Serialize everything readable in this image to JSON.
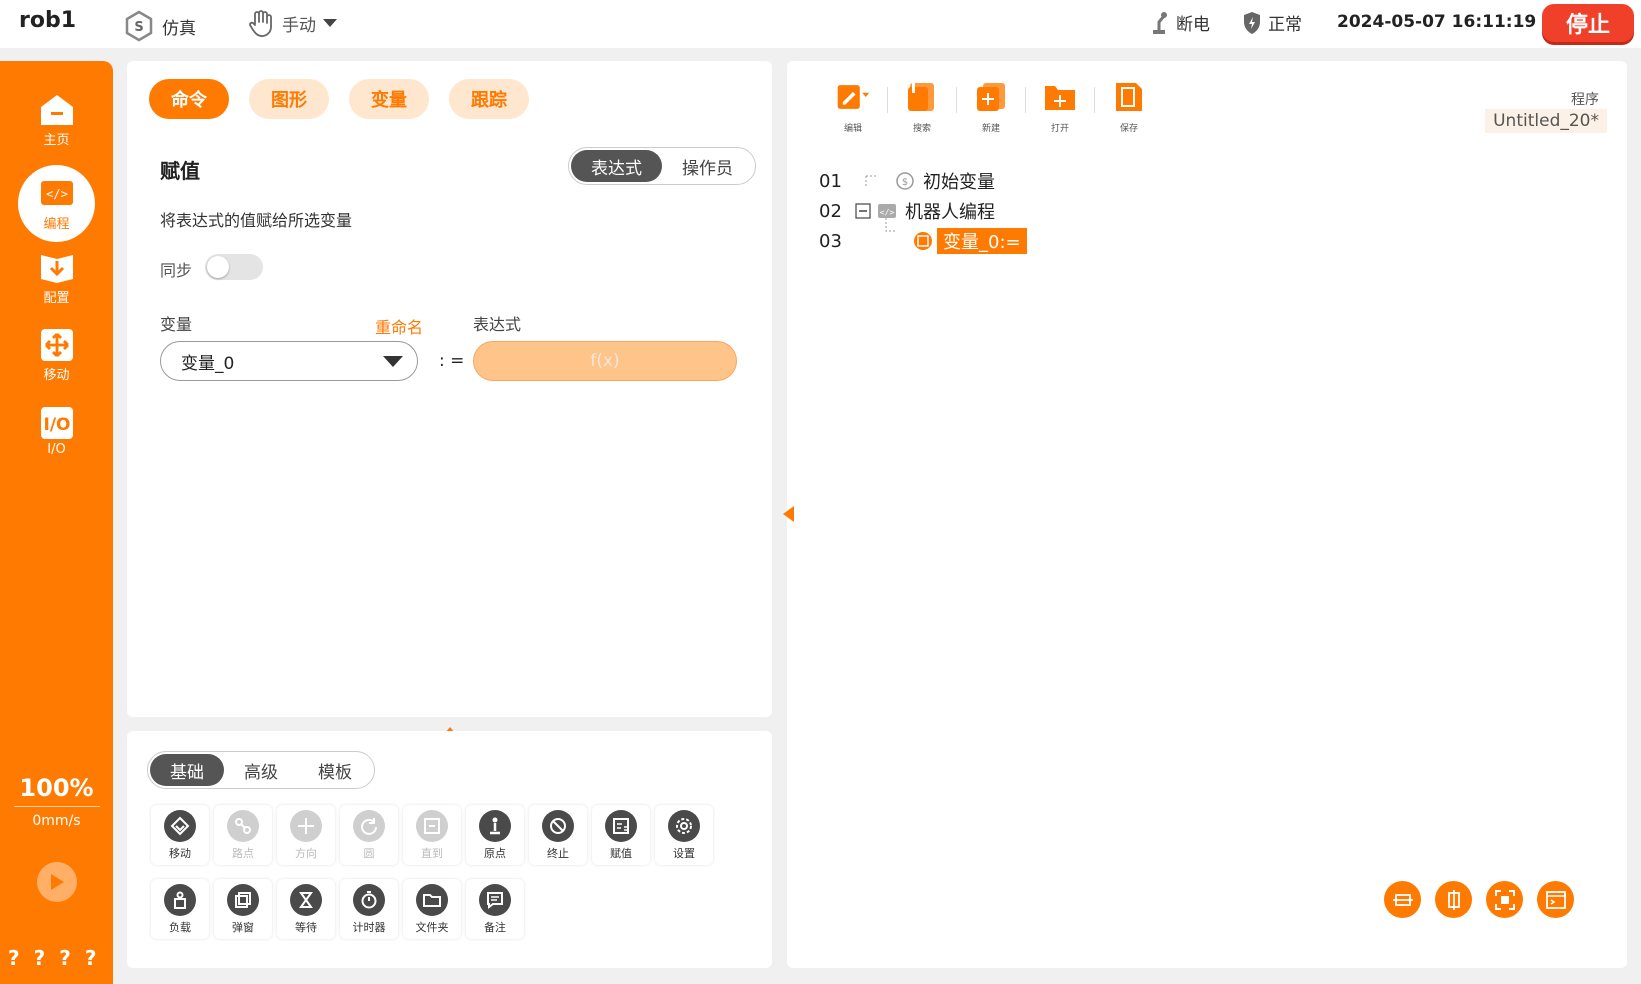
{
  "header": {
    "robot_name": "rob1",
    "sim_label": "仿真",
    "mode_label": "手动",
    "power_label": "断电",
    "status_label": "正常",
    "datetime": "2024-05-07 16:11:19",
    "stop_label": "停止"
  },
  "sidebar": {
    "items": [
      {
        "label": "主页",
        "icon": "home-icon"
      },
      {
        "label": "编程",
        "icon": "code-icon"
      },
      {
        "label": "配置",
        "icon": "download-book-icon"
      },
      {
        "label": "移动",
        "icon": "move-arrows-icon"
      },
      {
        "label": "I/O",
        "icon": "io-icon"
      }
    ],
    "speed_percent": "100%",
    "speed_mms": "0mm/s",
    "bottom_marks": [
      "?",
      "?",
      "?",
      "?"
    ]
  },
  "command_panel": {
    "tabs": [
      "命令",
      "图形",
      "变量",
      "跟踪"
    ],
    "mode_options": [
      "表达式",
      "操作员"
    ],
    "title": "赋值",
    "description": "将表达式的值赋给所选变量",
    "sync_label": "同步",
    "variable_label": "变量",
    "rename_label": "重命名",
    "expression_label": "表达式",
    "variable_value": "变量_0",
    "assign_operator": ": =",
    "expression_placeholder": "f(x)"
  },
  "library_panel": {
    "tabs": [
      "基础",
      "高级",
      "模板"
    ],
    "row1": [
      {
        "label": "移动",
        "icon": "move-diamond-icon",
        "enabled": true
      },
      {
        "label": "路点",
        "icon": "waypoint-icon",
        "enabled": false
      },
      {
        "label": "方向",
        "icon": "direction-icon",
        "enabled": false
      },
      {
        "label": "圆",
        "icon": "circle-arrow-icon",
        "enabled": false
      },
      {
        "label": "直到",
        "icon": "until-icon",
        "enabled": false
      },
      {
        "label": "原点",
        "icon": "origin-icon",
        "enabled": true
      },
      {
        "label": "终止",
        "icon": "stop-sign-icon",
        "enabled": true
      },
      {
        "label": "赋值",
        "icon": "assign-icon",
        "enabled": true
      },
      {
        "label": "设置",
        "icon": "gear-icon",
        "enabled": true
      }
    ],
    "row2": [
      {
        "label": "负载",
        "icon": "payload-icon",
        "enabled": true
      },
      {
        "label": "弹窗",
        "icon": "popup-icon",
        "enabled": true
      },
      {
        "label": "等待",
        "icon": "hourglass-icon",
        "enabled": true
      },
      {
        "label": "计时器",
        "icon": "timer-icon",
        "enabled": true
      },
      {
        "label": "文件夹",
        "icon": "folder-icon",
        "enabled": true
      },
      {
        "label": "备注",
        "icon": "comment-icon",
        "enabled": true
      }
    ]
  },
  "program_panel": {
    "toolbar": [
      {
        "label": "编辑",
        "icon": "edit-icon"
      },
      {
        "label": "搜索",
        "icon": "search-icon"
      },
      {
        "label": "新建",
        "icon": "new-file-icon"
      },
      {
        "label": "打开",
        "icon": "open-folder-icon"
      },
      {
        "label": "保存",
        "icon": "save-icon"
      }
    ],
    "program_label": "程序",
    "program_name": "Untitled_20*",
    "tree": [
      {
        "num": "01",
        "label": "初始变量"
      },
      {
        "num": "02",
        "label": "机器人编程"
      },
      {
        "num": "03",
        "label": "变量_0:="
      }
    ],
    "bottom_tools": [
      "expand-horizontal-icon",
      "expand-vertical-icon",
      "fit-view-icon",
      "terminal-icon"
    ]
  },
  "colors": {
    "accent": "#ff7a00",
    "stop": "#f0402a",
    "disabled": "#cfcfcf"
  }
}
